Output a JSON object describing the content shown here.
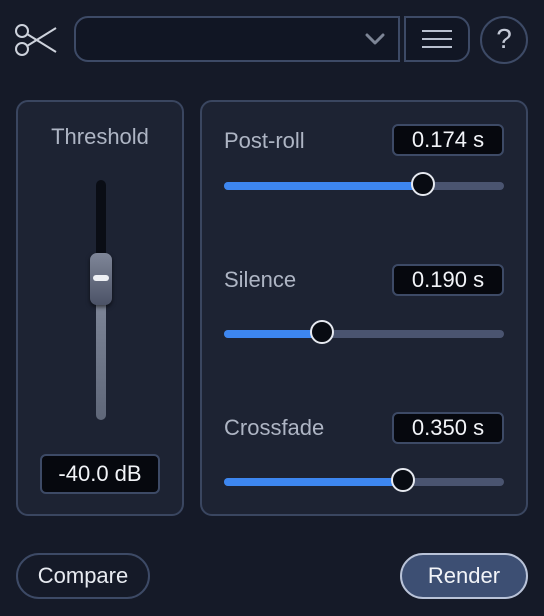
{
  "toolbar": {
    "tool_icon": "scissors-icon",
    "preset_value": "",
    "dropdown_icon": "chevron-down-icon",
    "menu_icon": "hamburger-menu-icon",
    "help_label": "?"
  },
  "threshold": {
    "title": "Threshold",
    "value_text": "-40.0 dB",
    "level_fraction": 0.52
  },
  "params": [
    {
      "label": "Post-roll",
      "value_text": "0.174 s",
      "position_fraction": 0.71
    },
    {
      "label": "Silence",
      "value_text": "0.190 s",
      "position_fraction": 0.35
    },
    {
      "label": "Crossfade",
      "value_text": "0.350 s",
      "position_fraction": 0.64
    }
  ],
  "buttons": {
    "compare": "Compare",
    "render": "Render"
  },
  "colors": {
    "accent": "#3d86f0",
    "background": "#151a28",
    "panel": "#1d2333"
  }
}
